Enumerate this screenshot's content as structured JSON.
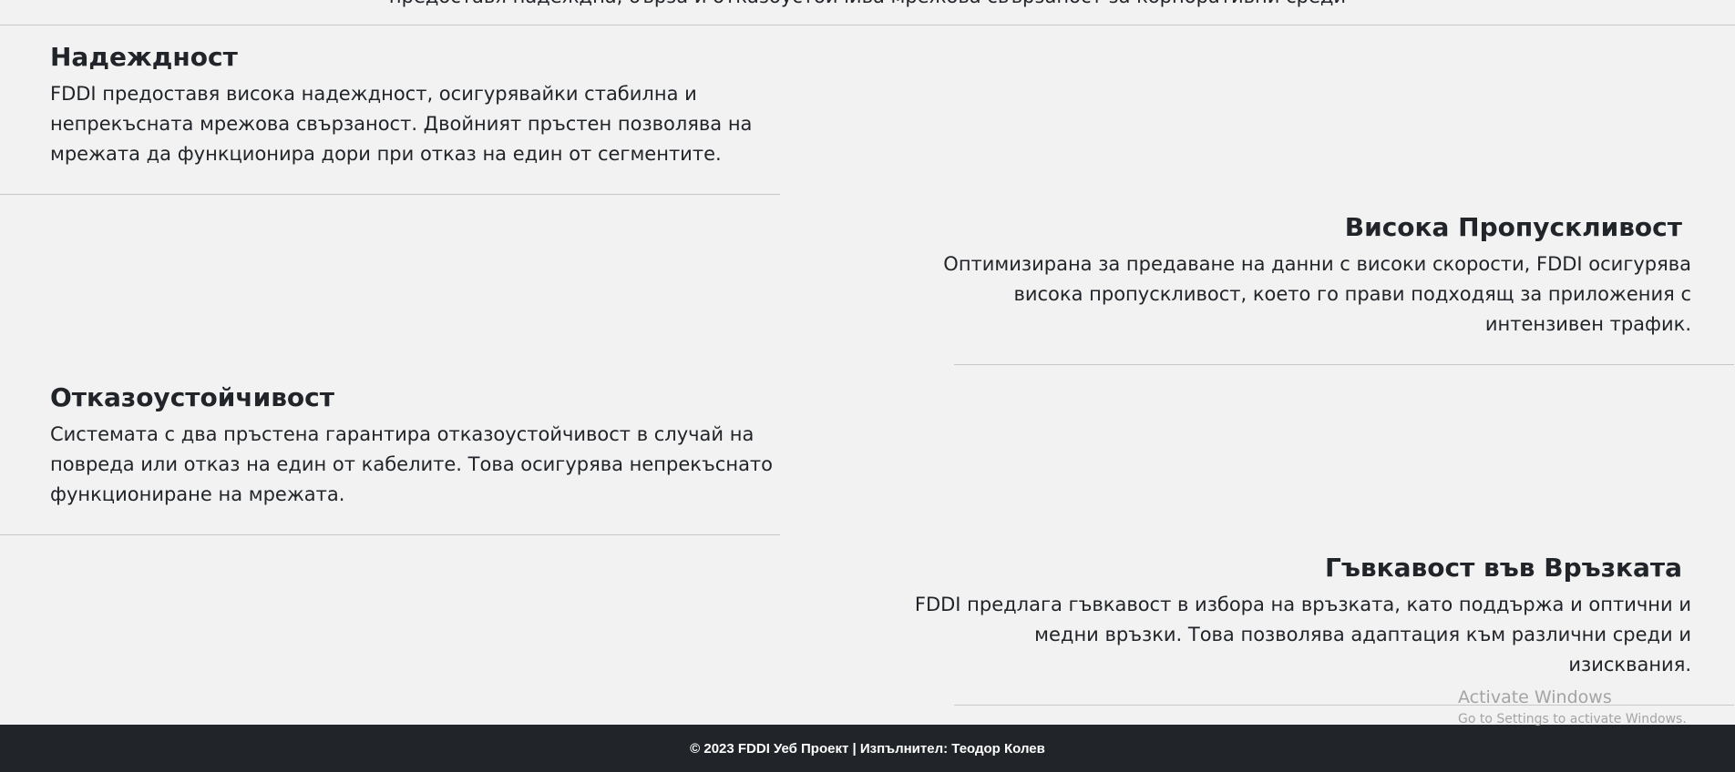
{
  "header": {
    "cut_text": "предоставя надеждна, бърза и отказоустойчива мрежова свързаност за корпоративни среди"
  },
  "features": [
    {
      "title": "Надеждност",
      "text": "FDDI предоставя висока надеждност, осигурявайки стабилна и непрекъсната мрежова свързаност. Двойният пръстен позволява на мрежата да функционира дори при отказ на един от сегментите."
    },
    {
      "title": "Висока Пропускливост",
      "text": "Оптимизирана за предаване на данни с високи скорости, FDDI осигурява висока пропускливост, което го прави подходящ за приложения с интензивен трафик."
    },
    {
      "title": "Отказоустойчивост",
      "text": "Системата с два пръстена гарантира отказоустойчивост в случай на повреда или отказ на един от кабелите. Това осигурява непрекъснато функциониране на мрежата."
    },
    {
      "title": "Гъвкавост във Връзката",
      "text": "FDDI предлага гъвкавост в избора на връзката, като поддържа и оптични и медни връзки. Това позволява адаптация към различни среди и изисквания."
    }
  ],
  "footer": {
    "text": "© 2023 FDDI Уеб Проект | Изпълнител: Теодор Колев"
  },
  "watermark": {
    "title": "Activate Windows",
    "subtitle": "Go to Settings to activate Windows."
  }
}
